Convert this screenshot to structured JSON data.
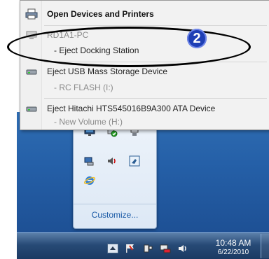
{
  "menu": {
    "open_devices": "Open Devices and Printers",
    "computer_name": "RD1A1-PC",
    "eject_dock": "- Eject Docking Station",
    "eject_usb": "Eject USB Mass Storage Device",
    "usb_volume": "- RC FLASH (I:)",
    "eject_hdd": "Eject Hitachi HTS545016B9A300 ATA Device",
    "hdd_volume": "- New Volume (H:)"
  },
  "annotation": {
    "step_number": "2"
  },
  "tray_panel": {
    "customize_label": "Customize..."
  },
  "taskbar": {
    "time": "10:48 AM",
    "date": "6/22/2010"
  },
  "colors": {
    "annotation_badge": "#1f3fb5",
    "link": "#1a5aa6",
    "taskbar": "#274a76"
  },
  "icons": [
    "printer-icon",
    "computer-icon",
    "drive-icon",
    "drive-icon",
    "network-icon",
    "power-icon",
    "monitor-icon",
    "network-drive-icon",
    "speaker-icon",
    "display-settings-icon",
    "internet-explorer-icon",
    "arrow-up-icon",
    "flag-icon",
    "safely-remove-icon",
    "network-icon",
    "speaker-icon"
  ]
}
